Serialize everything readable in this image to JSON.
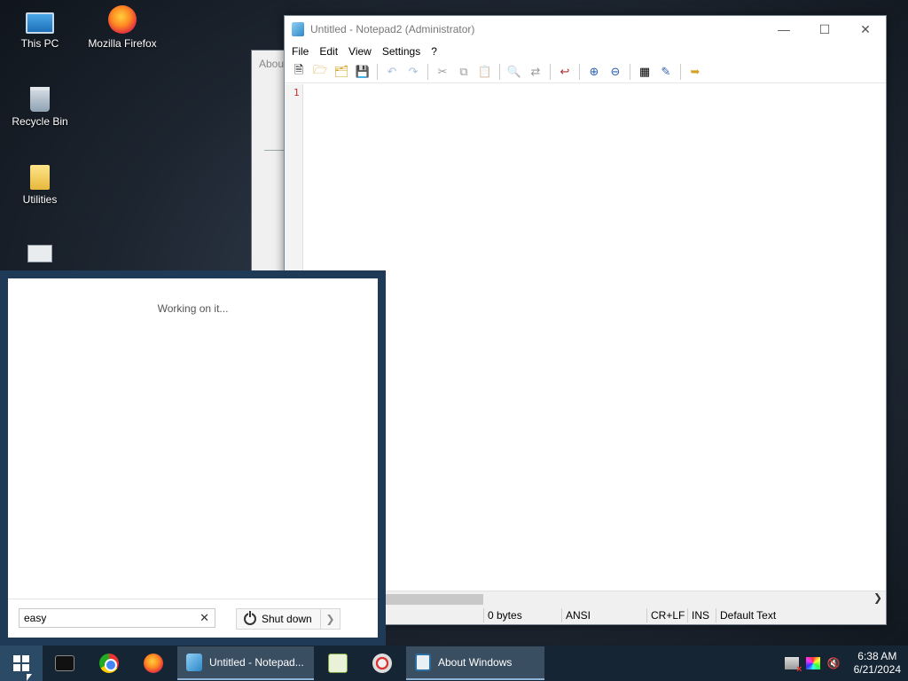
{
  "desktop": {
    "icons": [
      {
        "label": "This PC"
      },
      {
        "label": "Mozilla Firefox"
      },
      {
        "label": "Recycle Bin"
      },
      {
        "label": "Utilities"
      }
    ]
  },
  "about_window": {
    "title_partial": "Abou"
  },
  "notepad": {
    "title": "Untitled - Notepad2 (Administrator)",
    "menu": [
      "File",
      "Edit",
      "View",
      "Settings",
      "?"
    ],
    "line_number": "1",
    "status": {
      "size": "0 bytes",
      "encoding": "ANSI",
      "eol": "CR+LF",
      "mode": "INS",
      "scheme": "Default Text"
    }
  },
  "start_menu": {
    "status_text": "Working on it...",
    "search_value": "easy",
    "shutdown_label": "Shut down"
  },
  "taskbar": {
    "tasks": [
      {
        "label": "Untitled - Notepad..."
      },
      {
        "label": "About Windows"
      }
    ],
    "clock": {
      "time": "6:38 AM",
      "date": "6/21/2024"
    }
  }
}
